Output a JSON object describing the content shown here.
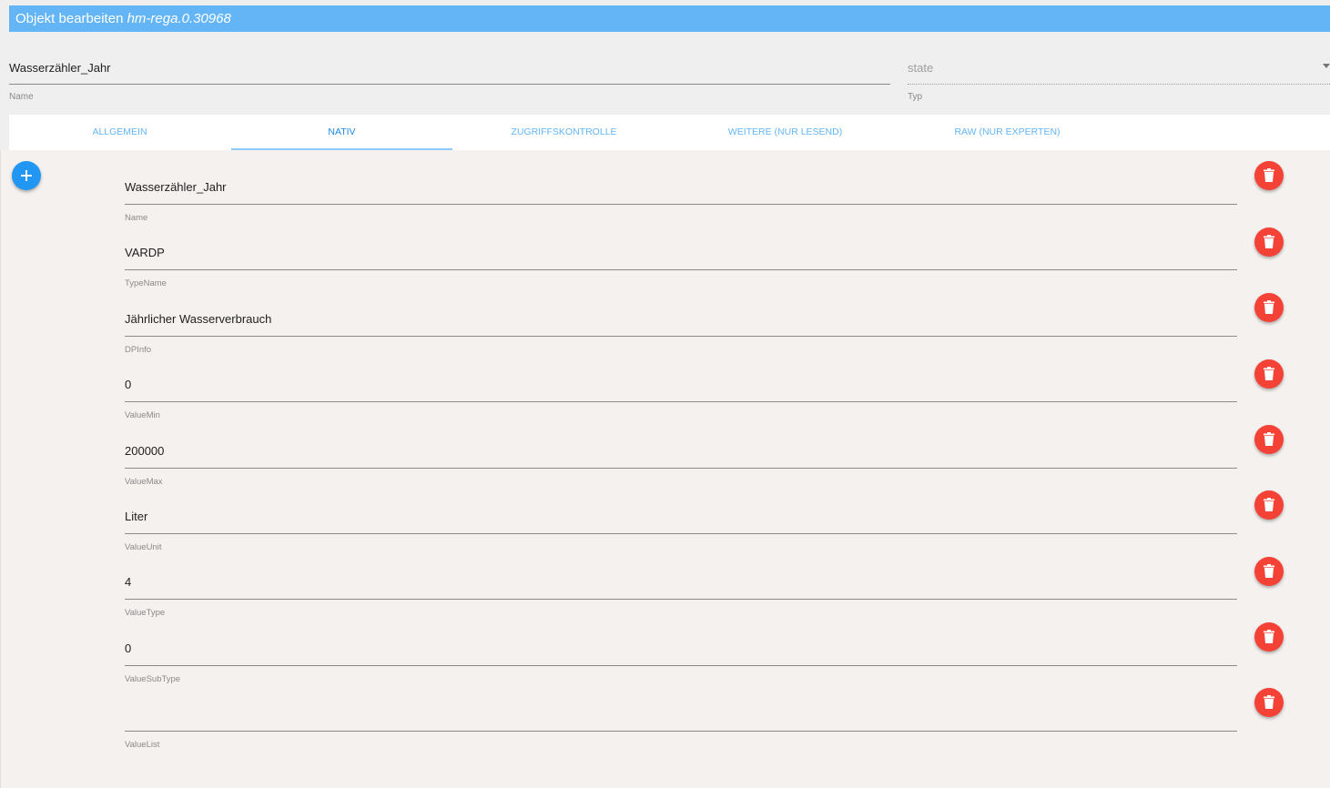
{
  "dialog": {
    "title_prefix": "Objekt bearbeiten",
    "object_id": "hm-rega.0.30968",
    "title_color": "#64b5f6"
  },
  "header": {
    "name": {
      "value": "Wasserzähler_Jahr",
      "label": "Name"
    },
    "type": {
      "value": "state",
      "label": "Typ"
    }
  },
  "tabs": [
    {
      "label": "Allgemein",
      "active": false
    },
    {
      "label": "Nativ",
      "active": true
    },
    {
      "label": "Zugriffskontrolle",
      "active": false
    },
    {
      "label": "Weitere (nur lesend)",
      "active": false
    },
    {
      "label": "Raw (nur Experten)",
      "active": false
    }
  ],
  "native_fields": [
    {
      "label": "Name",
      "value": "Wasserzähler_Jahr"
    },
    {
      "label": "TypeName",
      "value": "VARDP"
    },
    {
      "label": "DPInfo",
      "value": "Jährlicher Wasserverbrauch"
    },
    {
      "label": "ValueMin",
      "value": "0"
    },
    {
      "label": "ValueMax",
      "value": "200000"
    },
    {
      "label": "ValueUnit",
      "value": "Liter"
    },
    {
      "label": "ValueType",
      "value": "4"
    },
    {
      "label": "ValueSubType",
      "value": "0"
    },
    {
      "label": "ValueList",
      "value": ""
    }
  ],
  "icons": {
    "add": "plus-icon",
    "delete": "trash-icon"
  },
  "colors": {
    "accent": "#2196f3",
    "danger": "#f44336",
    "tab_text": "#64b5f6"
  }
}
